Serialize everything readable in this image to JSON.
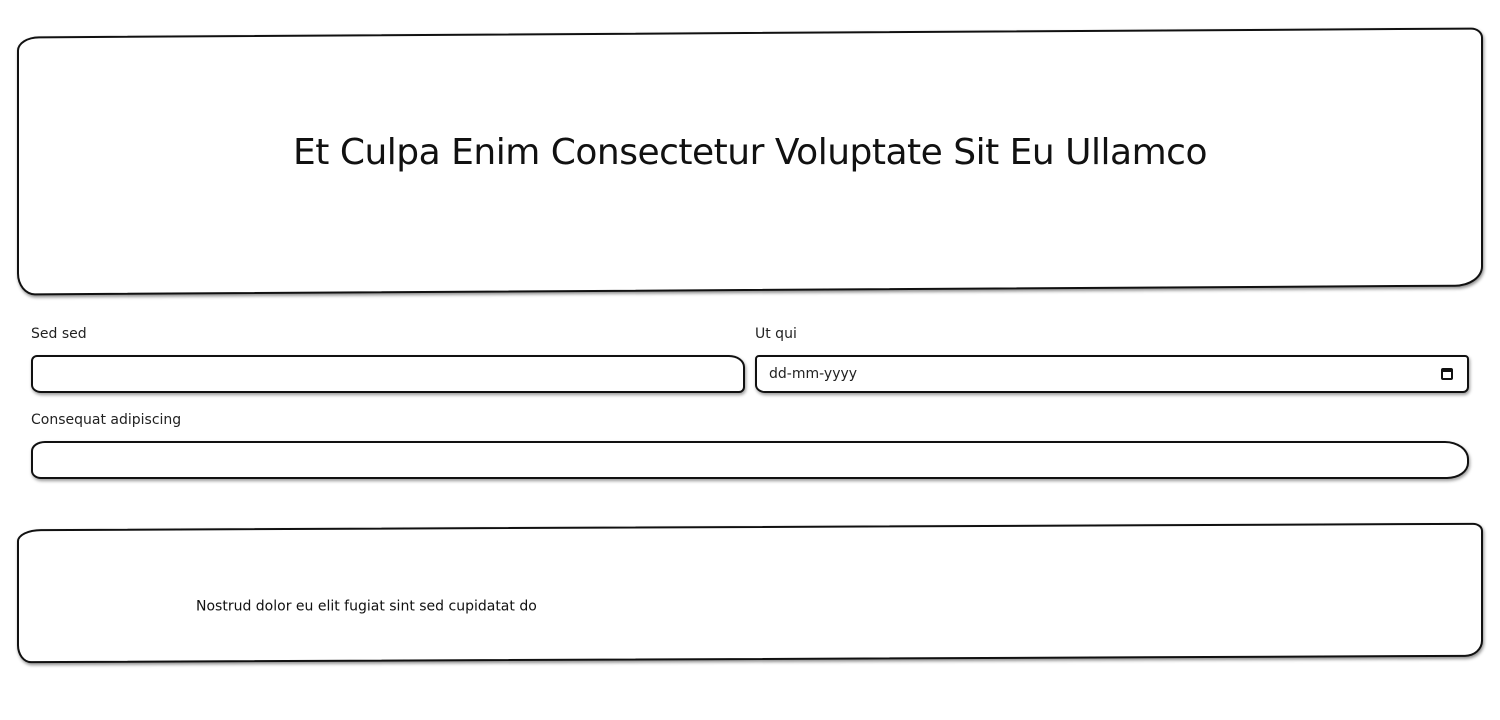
{
  "header": {
    "title": "Et Culpa Enim Consectetur Voluptate Sit Eu Ullamco"
  },
  "form": {
    "field1": {
      "label": "Sed sed",
      "value": ""
    },
    "field2": {
      "label": "Ut qui",
      "value": "",
      "placeholder": "dd-mm-yyyy",
      "icon": "calendar-icon"
    },
    "field3": {
      "label": "Consequat adipiscing",
      "value": ""
    }
  },
  "footer": {
    "text": "Nostrud dolor eu elit fugiat sint sed cupidatat do"
  }
}
